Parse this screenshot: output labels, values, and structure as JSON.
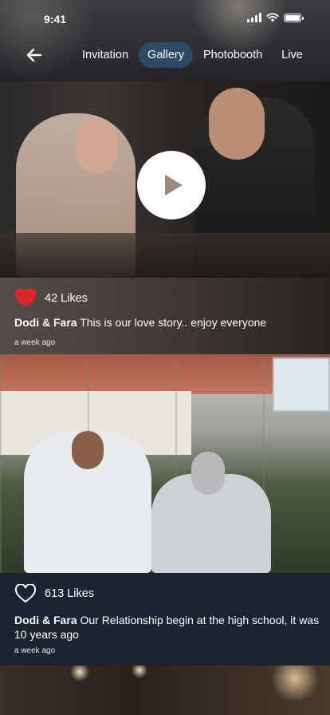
{
  "status_bar": {
    "time": "9:41"
  },
  "nav": {
    "tabs": [
      {
        "label": "Invitation",
        "active": false
      },
      {
        "label": "Gallery",
        "active": true
      },
      {
        "label": "Photobooth",
        "active": false
      },
      {
        "label": "Live",
        "active": false
      }
    ]
  },
  "posts": [
    {
      "media": "video",
      "liked": true,
      "likes_label": "42 Likes",
      "author": "Dodi & Fara",
      "text": "This is our love story.. enjoy everyone",
      "time_ago": "a week ago"
    },
    {
      "media": "photo",
      "liked": false,
      "likes_label": "613 Likes",
      "author": "Dodi & Fara",
      "text": "Our Relationship begin at the high school, it was 10 years ago",
      "time_ago": "a week ago"
    }
  ],
  "colors": {
    "accent_tab": "#2e4a66",
    "heart_liked": "#e0242c",
    "panel_bg": "#1b2430"
  },
  "icons": [
    "back-arrow-icon",
    "play-icon",
    "heart-filled-icon",
    "heart-outline-icon",
    "wifi-icon",
    "signal-icon",
    "battery-icon"
  ]
}
